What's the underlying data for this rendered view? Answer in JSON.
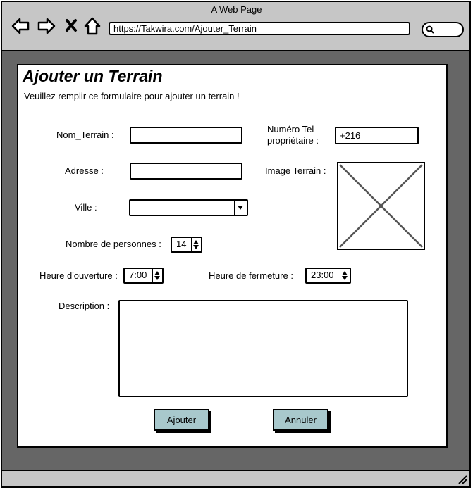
{
  "browser": {
    "window_title": "A Web Page",
    "url": "https://Takwira.com/Ajouter_Terrain"
  },
  "page": {
    "title": "Ajouter un Terrain",
    "subtitle": "Veuillez remplir ce formulaire pour ajouter un terrain !"
  },
  "form": {
    "nom_label": "Nom_Terrain :",
    "adresse_label": "Adresse  :",
    "ville_label": "Ville :",
    "nombre_label": "Nombre de personnes :",
    "nombre_value": "14",
    "heure_ouverture_label": "Heure d'ouverture :",
    "heure_ouverture_value": "7:00",
    "heure_fermeture_label": "Heure de fermeture :",
    "heure_fermeture_value": "23:00",
    "description_label": "Description :",
    "tel_label_line1": "Numéro Tel",
    "tel_label_line2": "propriétaire :",
    "tel_prefix": "+216",
    "image_label": "Image Terrain :"
  },
  "buttons": {
    "ajouter": "Ajouter",
    "annuler": "Annuler"
  },
  "colors": {
    "chrome": "#c6c6c6",
    "frame": "#666666",
    "button": "#a8c8cc"
  }
}
